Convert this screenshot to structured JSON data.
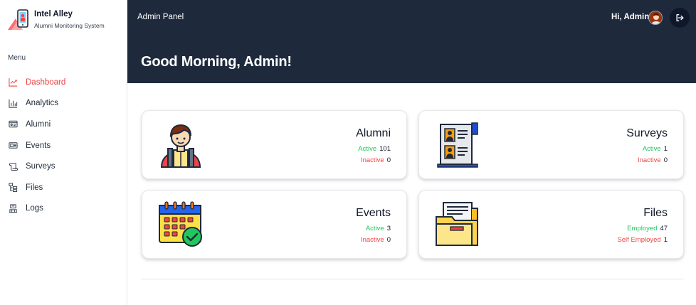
{
  "brand": {
    "name": "Intel Alley",
    "subtitle": "Alumni Monitoring System"
  },
  "sidebar": {
    "heading": "Menu",
    "items": [
      {
        "label": "Dashboard",
        "icon": "chart-line-icon",
        "active": true
      },
      {
        "label": "Analytics",
        "icon": "bar-chart-icon",
        "active": false
      },
      {
        "label": "Alumni",
        "icon": "id-card-icon",
        "active": false
      },
      {
        "label": "Events",
        "icon": "ticket-icon",
        "active": false
      },
      {
        "label": "Surveys",
        "icon": "scroll-icon",
        "active": false
      },
      {
        "label": "Files",
        "icon": "folder-tree-icon",
        "active": false
      },
      {
        "label": "Logs",
        "icon": "logs-icon",
        "active": false
      }
    ]
  },
  "header": {
    "panel_title": "Admin Panel",
    "greeting": "Hi, Admin",
    "page_title": "Good Morning, Admin!"
  },
  "cards": {
    "alumni": {
      "title": "Alumni",
      "stat1_label": "Active",
      "stat1_value": "101",
      "stat2_label": "Inactive",
      "stat2_value": "0"
    },
    "surveys": {
      "title": "Surveys",
      "stat1_label": "Active",
      "stat1_value": "1",
      "stat2_label": "Inactive",
      "stat2_value": "0"
    },
    "events": {
      "title": "Events",
      "stat1_label": "Active",
      "stat1_value": "3",
      "stat2_label": "Inactive",
      "stat2_value": "0"
    },
    "files": {
      "title": "Files",
      "stat1_label": "Employed",
      "stat1_value": "47",
      "stat2_label": "Self Employed",
      "stat2_value": "1"
    }
  },
  "colors": {
    "header_bg": "#1e293b",
    "active_nav": "#ef4444",
    "positive": "#22c55e",
    "negative": "#ef4444"
  }
}
